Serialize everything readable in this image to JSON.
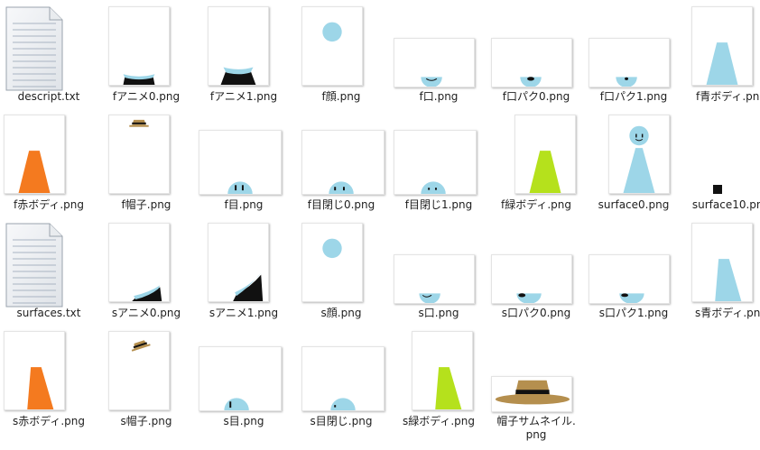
{
  "files": [
    {
      "name": "descript.txt",
      "kind": "text"
    },
    {
      "name": "fアニメ0.png",
      "kind": "anim-f0"
    },
    {
      "name": "fアニメ1.png",
      "kind": "anim-f1"
    },
    {
      "name": "f顔.png",
      "kind": "face"
    },
    {
      "name": "f口.png",
      "kind": "mouth-f"
    },
    {
      "name": "f口パク0.png",
      "kind": "mouthpaku-f0"
    },
    {
      "name": "f口パク1.png",
      "kind": "mouthpaku-f1"
    },
    {
      "name": "f青ボディ.png",
      "kind": "body-f-blue"
    },
    {
      "name": "f赤ボディ.png",
      "kind": "body-f-red"
    },
    {
      "name": "f帽子.png",
      "kind": "hat-f"
    },
    {
      "name": "f目.png",
      "kind": "eyes-f"
    },
    {
      "name": "f目閉じ0.png",
      "kind": "eyesclosed-f0"
    },
    {
      "name": "f目閉じ1.png",
      "kind": "eyesclosed-f1"
    },
    {
      "name": "f緑ボディ.png",
      "kind": "body-f-green"
    },
    {
      "name": "surface0.png",
      "kind": "surface0"
    },
    {
      "name": "surface10.png",
      "kind": "surface10"
    },
    {
      "name": "surfaces.txt",
      "kind": "text"
    },
    {
      "name": "sアニメ0.png",
      "kind": "anim-s0"
    },
    {
      "name": "sアニメ1.png",
      "kind": "anim-s1"
    },
    {
      "name": "s顔.png",
      "kind": "face"
    },
    {
      "name": "s口.png",
      "kind": "mouth-s"
    },
    {
      "name": "s口パク0.png",
      "kind": "mouthpaku-s0"
    },
    {
      "name": "s口パク1.png",
      "kind": "mouthpaku-s1"
    },
    {
      "name": "s青ボディ.png",
      "kind": "body-s-blue"
    },
    {
      "name": "s赤ボディ.png",
      "kind": "body-s-red"
    },
    {
      "name": "s帽子.png",
      "kind": "hat-s"
    },
    {
      "name": "s目.png",
      "kind": "eyes-s"
    },
    {
      "name": "s目閉じ.png",
      "kind": "eyesclosed-s"
    },
    {
      "name": "s緑ボディ.png",
      "kind": "body-s-green"
    },
    {
      "name": "帽子サムネイル.\npng",
      "kind": "hat-thumb"
    }
  ],
  "colors": {
    "skin": "#9dd6e8",
    "red": "#f47a1f",
    "green": "#b5e11c",
    "hat": "#b58f4e",
    "black": "#111111"
  }
}
